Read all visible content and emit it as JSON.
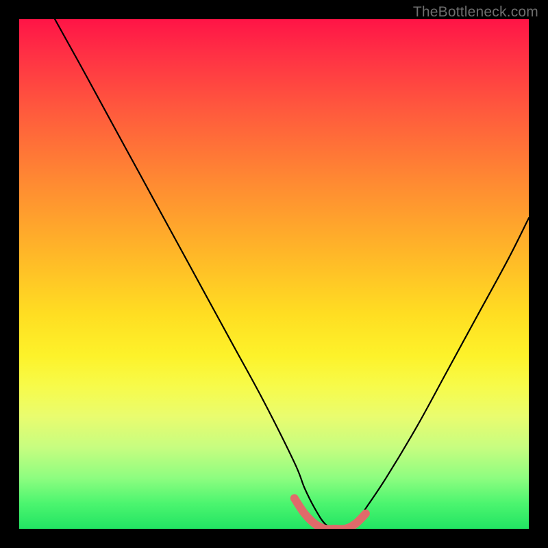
{
  "watermark": "TheBottleneck.com",
  "chart_data": {
    "type": "line",
    "title": "",
    "xlabel": "",
    "ylabel": "",
    "xlim": [
      0,
      100
    ],
    "ylim": [
      0,
      100
    ],
    "grid": false,
    "legend": false,
    "annotations": [],
    "series": [
      {
        "name": "main-curve",
        "color": "#000000",
        "x": [
          7,
          12,
          18,
          24,
          30,
          36,
          42,
          48,
          54,
          56,
          58,
          60,
          62,
          64,
          66,
          68,
          72,
          78,
          84,
          90,
          96,
          100
        ],
        "y": [
          100,
          91,
          80,
          69,
          58,
          47,
          36,
          25,
          13,
          8,
          4,
          1,
          0,
          0,
          1,
          4,
          10,
          20,
          31,
          42,
          53,
          61
        ]
      },
      {
        "name": "valley-highlight",
        "color": "#e06a6a",
        "x": [
          54,
          56,
          58,
          60,
          62,
          64,
          66,
          68
        ],
        "y": [
          6,
          3,
          1,
          0,
          0,
          0,
          1,
          3
        ]
      }
    ],
    "background_gradient_stops": [
      {
        "pos": 0,
        "color": "#ff1446"
      },
      {
        "pos": 18,
        "color": "#ff5a3d"
      },
      {
        "pos": 46,
        "color": "#ffb728"
      },
      {
        "pos": 72,
        "color": "#f7fb4a"
      },
      {
        "pos": 90,
        "color": "#8efd80"
      },
      {
        "pos": 100,
        "color": "#22e463"
      }
    ]
  }
}
